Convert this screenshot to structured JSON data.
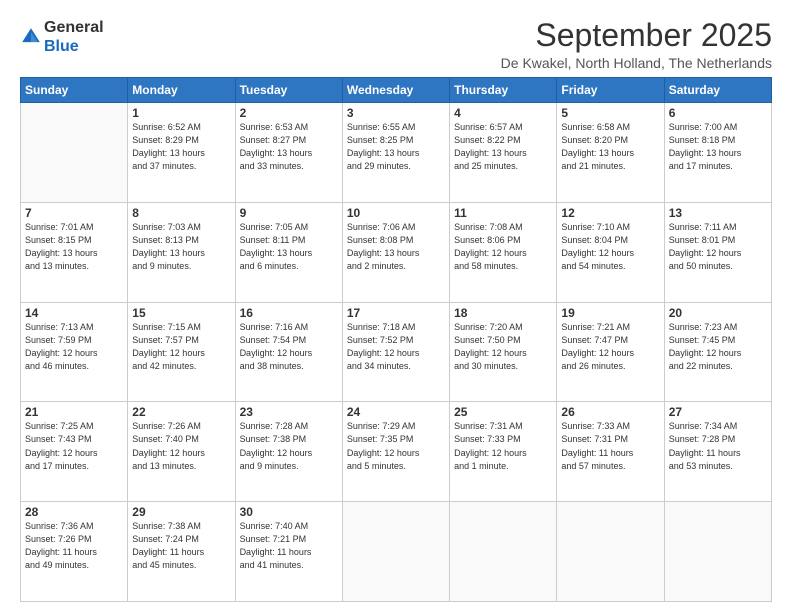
{
  "logo": {
    "general": "General",
    "blue": "Blue"
  },
  "header": {
    "month": "September 2025",
    "location": "De Kwakel, North Holland, The Netherlands"
  },
  "weekdays": [
    "Sunday",
    "Monday",
    "Tuesday",
    "Wednesday",
    "Thursday",
    "Friday",
    "Saturday"
  ],
  "weeks": [
    [
      {
        "day": "",
        "info": ""
      },
      {
        "day": "1",
        "info": "Sunrise: 6:52 AM\nSunset: 8:29 PM\nDaylight: 13 hours\nand 37 minutes."
      },
      {
        "day": "2",
        "info": "Sunrise: 6:53 AM\nSunset: 8:27 PM\nDaylight: 13 hours\nand 33 minutes."
      },
      {
        "day": "3",
        "info": "Sunrise: 6:55 AM\nSunset: 8:25 PM\nDaylight: 13 hours\nand 29 minutes."
      },
      {
        "day": "4",
        "info": "Sunrise: 6:57 AM\nSunset: 8:22 PM\nDaylight: 13 hours\nand 25 minutes."
      },
      {
        "day": "5",
        "info": "Sunrise: 6:58 AM\nSunset: 8:20 PM\nDaylight: 13 hours\nand 21 minutes."
      },
      {
        "day": "6",
        "info": "Sunrise: 7:00 AM\nSunset: 8:18 PM\nDaylight: 13 hours\nand 17 minutes."
      }
    ],
    [
      {
        "day": "7",
        "info": "Sunrise: 7:01 AM\nSunset: 8:15 PM\nDaylight: 13 hours\nand 13 minutes."
      },
      {
        "day": "8",
        "info": "Sunrise: 7:03 AM\nSunset: 8:13 PM\nDaylight: 13 hours\nand 9 minutes."
      },
      {
        "day": "9",
        "info": "Sunrise: 7:05 AM\nSunset: 8:11 PM\nDaylight: 13 hours\nand 6 minutes."
      },
      {
        "day": "10",
        "info": "Sunrise: 7:06 AM\nSunset: 8:08 PM\nDaylight: 13 hours\nand 2 minutes."
      },
      {
        "day": "11",
        "info": "Sunrise: 7:08 AM\nSunset: 8:06 PM\nDaylight: 12 hours\nand 58 minutes."
      },
      {
        "day": "12",
        "info": "Sunrise: 7:10 AM\nSunset: 8:04 PM\nDaylight: 12 hours\nand 54 minutes."
      },
      {
        "day": "13",
        "info": "Sunrise: 7:11 AM\nSunset: 8:01 PM\nDaylight: 12 hours\nand 50 minutes."
      }
    ],
    [
      {
        "day": "14",
        "info": "Sunrise: 7:13 AM\nSunset: 7:59 PM\nDaylight: 12 hours\nand 46 minutes."
      },
      {
        "day": "15",
        "info": "Sunrise: 7:15 AM\nSunset: 7:57 PM\nDaylight: 12 hours\nand 42 minutes."
      },
      {
        "day": "16",
        "info": "Sunrise: 7:16 AM\nSunset: 7:54 PM\nDaylight: 12 hours\nand 38 minutes."
      },
      {
        "day": "17",
        "info": "Sunrise: 7:18 AM\nSunset: 7:52 PM\nDaylight: 12 hours\nand 34 minutes."
      },
      {
        "day": "18",
        "info": "Sunrise: 7:20 AM\nSunset: 7:50 PM\nDaylight: 12 hours\nand 30 minutes."
      },
      {
        "day": "19",
        "info": "Sunrise: 7:21 AM\nSunset: 7:47 PM\nDaylight: 12 hours\nand 26 minutes."
      },
      {
        "day": "20",
        "info": "Sunrise: 7:23 AM\nSunset: 7:45 PM\nDaylight: 12 hours\nand 22 minutes."
      }
    ],
    [
      {
        "day": "21",
        "info": "Sunrise: 7:25 AM\nSunset: 7:43 PM\nDaylight: 12 hours\nand 17 minutes."
      },
      {
        "day": "22",
        "info": "Sunrise: 7:26 AM\nSunset: 7:40 PM\nDaylight: 12 hours\nand 13 minutes."
      },
      {
        "day": "23",
        "info": "Sunrise: 7:28 AM\nSunset: 7:38 PM\nDaylight: 12 hours\nand 9 minutes."
      },
      {
        "day": "24",
        "info": "Sunrise: 7:29 AM\nSunset: 7:35 PM\nDaylight: 12 hours\nand 5 minutes."
      },
      {
        "day": "25",
        "info": "Sunrise: 7:31 AM\nSunset: 7:33 PM\nDaylight: 12 hours\nand 1 minute."
      },
      {
        "day": "26",
        "info": "Sunrise: 7:33 AM\nSunset: 7:31 PM\nDaylight: 11 hours\nand 57 minutes."
      },
      {
        "day": "27",
        "info": "Sunrise: 7:34 AM\nSunset: 7:28 PM\nDaylight: 11 hours\nand 53 minutes."
      }
    ],
    [
      {
        "day": "28",
        "info": "Sunrise: 7:36 AM\nSunset: 7:26 PM\nDaylight: 11 hours\nand 49 minutes."
      },
      {
        "day": "29",
        "info": "Sunrise: 7:38 AM\nSunset: 7:24 PM\nDaylight: 11 hours\nand 45 minutes."
      },
      {
        "day": "30",
        "info": "Sunrise: 7:40 AM\nSunset: 7:21 PM\nDaylight: 11 hours\nand 41 minutes."
      },
      {
        "day": "",
        "info": ""
      },
      {
        "day": "",
        "info": ""
      },
      {
        "day": "",
        "info": ""
      },
      {
        "day": "",
        "info": ""
      }
    ]
  ]
}
